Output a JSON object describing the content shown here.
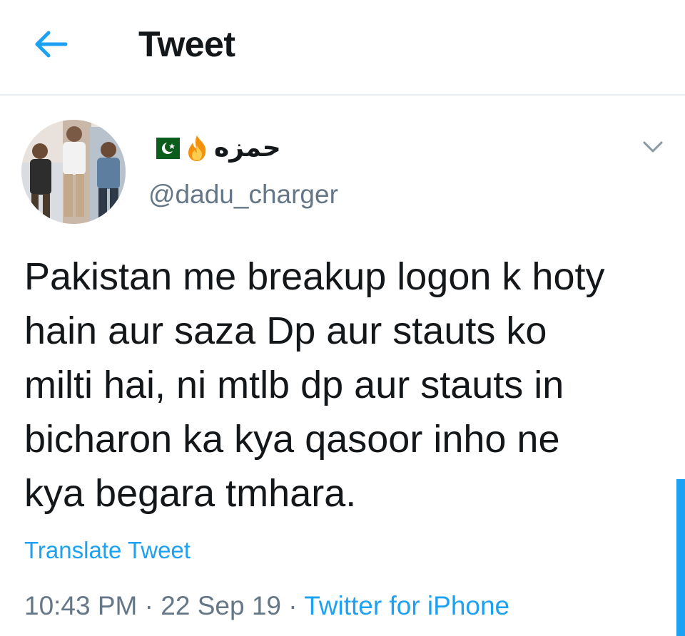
{
  "header": {
    "title": "Tweet",
    "back_icon": "arrow-left-icon"
  },
  "author": {
    "display_name": "حمزه",
    "emoji": [
      "fire-icon",
      "pakistan-flag-icon"
    ],
    "handle": "@dadu_charger"
  },
  "tweet": {
    "text": "Pakistan me breakup logon k hoty\nhain aur saza Dp aur stauts ko\nmilti hai, ni mtlb dp aur stauts in\nbicharon ka kya qasoor inho ne\nkya begara tmhara.",
    "translate_label": "Translate Tweet",
    "time": "10:43 PM",
    "separator": "·",
    "date": "22 Sep 19",
    "source": "Twitter for iPhone"
  },
  "colors": {
    "accent": "#1da1f2",
    "secondary_text": "#657786",
    "primary_text": "#14171a",
    "divider": "#e6ecf0"
  }
}
